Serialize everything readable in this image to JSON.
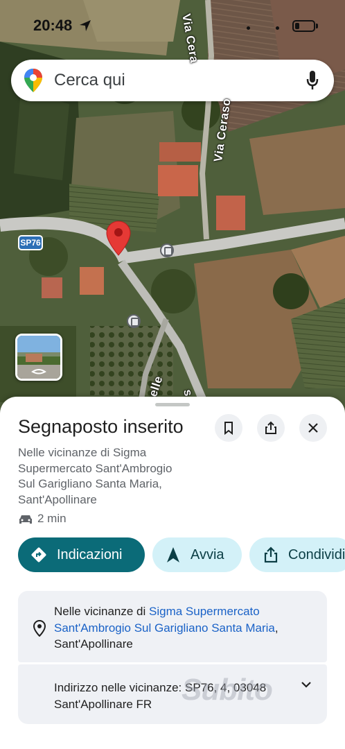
{
  "status_bar": {
    "time": "20:48"
  },
  "search": {
    "placeholder": "Cerca qui"
  },
  "map": {
    "road_labels": [
      "Via Cera",
      "Via Ceraso",
      "celle",
      "s"
    ],
    "road_shield": "SP76"
  },
  "place": {
    "title": "Segnaposto inserito",
    "address_lines": [
      "Nelle vicinanze di Sigma",
      "Supermercato Sant'Ambrogio",
      "Sul Garigliano Santa Maria,",
      "Sant'Apollinare"
    ],
    "eta": "2 min"
  },
  "actions": {
    "directions": "Indicazioni",
    "start": "Avvia",
    "share": "Condividi"
  },
  "details": {
    "near_prefix": "Nelle vicinanze di ",
    "near_link": "Sigma Supermercato Sant'Ambrogio Sul Garigliano Santa Maria",
    "near_suffix": ", Sant'Apollinare",
    "nearby_address": "Indirizzo nelle vicinanze: SP76, 4, 03048 Sant'Apollinare FR"
  },
  "watermark": "Subito",
  "colors": {
    "primary_button": "#0b6b78",
    "secondary_button": "#d3f1f8",
    "pin_red": "#e53935",
    "link": "#1a62c7"
  },
  "icons": [
    "location-arrow-icon",
    "maps-pin-icon",
    "mic-icon",
    "red-pin-icon",
    "bus-stop-icon",
    "bookmark-icon",
    "share-icon",
    "close-icon",
    "car-icon",
    "directions-icon",
    "navigation-arrow-icon",
    "location-pin-icon",
    "chevron-down-icon"
  ]
}
